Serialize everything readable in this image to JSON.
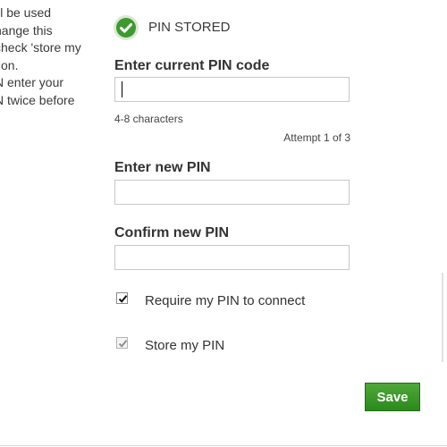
{
  "sidebar": {
    "description_lines": [
      "ill be used",
      "hange this",
      "check 'store my",
      "tion.",
      "N enter your",
      "N twice before"
    ]
  },
  "status": {
    "text": "PIN STORED",
    "icon": "check-circle-icon",
    "color": "#3c9a2e"
  },
  "current_pin": {
    "label": "Enter current PIN code",
    "value": "",
    "hint": "4-8 characters",
    "attempt_text": "Attempt 1 of 3"
  },
  "new_pin": {
    "label": "Enter new PIN",
    "value": ""
  },
  "confirm_pin": {
    "label": "Confirm new PIN",
    "value": ""
  },
  "options": {
    "require_pin": {
      "label": "Require my PIN to connect",
      "checked": true,
      "disabled": false
    },
    "store_pin": {
      "label": "Store my PIN",
      "checked": true,
      "disabled": true
    }
  },
  "actions": {
    "save_label": "Save",
    "save_color": "#2f8f22"
  }
}
